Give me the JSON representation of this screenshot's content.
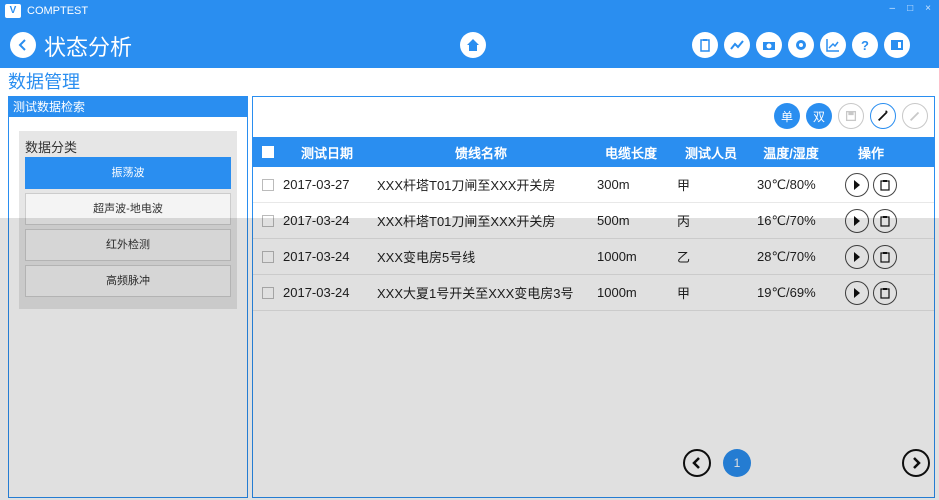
{
  "app": {
    "title": "COMPTEST",
    "logo_text": "V"
  },
  "header": {
    "page_title": "状态分析",
    "section_title": "数据管理"
  },
  "left_panel": {
    "header": "测试数据检索",
    "category_title": "数据分类",
    "items": [
      {
        "label": "振荡波",
        "active": true
      },
      {
        "label": "超声波-地电波",
        "active": false
      },
      {
        "label": "红外检测",
        "active": false
      },
      {
        "label": "高频脉冲",
        "active": false
      }
    ]
  },
  "right_panel": {
    "actions": [
      {
        "label": "单",
        "style": "primary"
      },
      {
        "label": "双",
        "style": "primary"
      }
    ],
    "table": {
      "headers": [
        "测试日期",
        "馈线名称",
        "电缆长度",
        "测试人员",
        "温度/湿度",
        "操作"
      ],
      "rows": [
        {
          "date": "2017-03-27",
          "feeder": "XXX杆塔T01刀闸至XXX开关房",
          "length": "300m",
          "person": "甲",
          "temp": "30℃/80%"
        },
        {
          "date": "2017-03-24",
          "feeder": "XXX杆塔T01刀闸至XXX开关房",
          "length": "500m",
          "person": "丙",
          "temp": "16℃/70%"
        },
        {
          "date": "2017-03-24",
          "feeder": "XXX变电房5号线",
          "length": "1000m",
          "person": "乙",
          "temp": "28℃/70%"
        },
        {
          "date": "2017-03-24",
          "feeder": "XXX大夏1号开关至XXX变电房3号",
          "length": "1000m",
          "person": "甲",
          "temp": "19℃/69%"
        }
      ]
    },
    "pagination": {
      "current_page": "1"
    }
  },
  "colors": {
    "accent": "#2a8ef0"
  }
}
